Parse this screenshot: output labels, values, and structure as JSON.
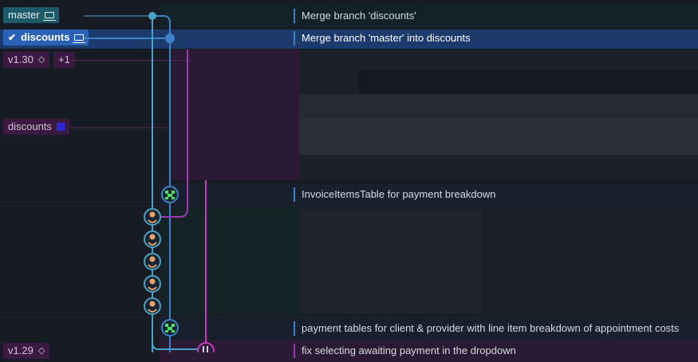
{
  "refs": {
    "master": "master",
    "discounts": "discounts",
    "tag_v130": "v1.30",
    "tag_count": "+1",
    "remote_discounts": "discounts",
    "tag_v129": "v1.29"
  },
  "commits": [
    {
      "message": "Merge branch 'discounts'"
    },
    {
      "message": "Merge branch 'master' into discounts"
    },
    {
      "message": "InvoiceItemsTable for payment breakdown"
    },
    {
      "message": "payment tables for client & provider with line item breakdown of appointment costs"
    },
    {
      "message": "fix selecting awaiting payment in the dropdown"
    }
  ],
  "icons": {
    "laptop": "laptop-icon",
    "check": "check-icon",
    "tag": "tag-icon",
    "avatar_green": "avatar-green-icon",
    "avatar_orange": "avatar-orange-icon"
  },
  "colors": {
    "background": "#161b24",
    "selected_row": "#1c3a6b",
    "master_ref": "#1f5a68",
    "discounts_ref": "#2a62b8",
    "tag_ref": "#3a1a40",
    "lane_blue": "#3e82c7",
    "lane_cyan": "#4aa3c9",
    "lane_purple": "#9d3bb5",
    "lane_magenta": "#c33bb8"
  }
}
